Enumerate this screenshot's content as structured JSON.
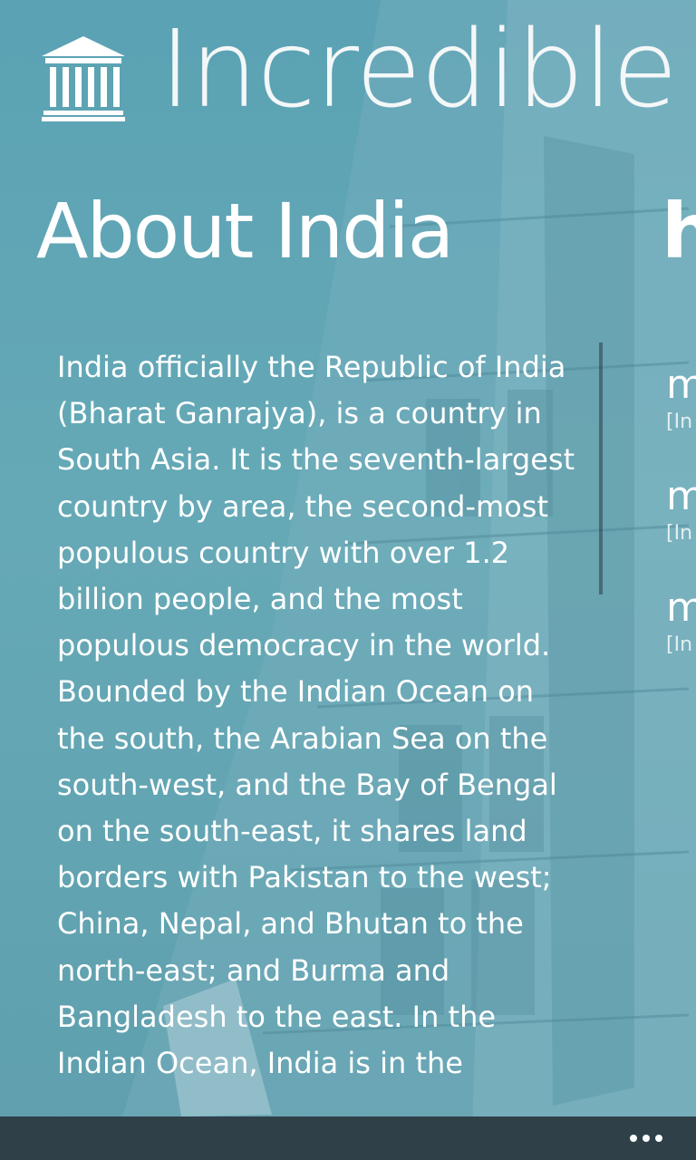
{
  "app": {
    "title": "Incredible",
    "icon": "museum-icon"
  },
  "pivot": {
    "current_header": "About India",
    "next_header_peek": "h"
  },
  "about": {
    "text": "India officially the Republic of India (Bharat Ganrajya), is a country in South Asia. It is the seventh-largest country by area, the second-most populous country with over 1.2 billion people, and the most populous democracy in the world. Bounded by the Indian Ocean on the south, the Arabian Sea on the south-west, and the Bay of Bengal on the south-east, it shares land borders with Pakistan to the west; China, Nepal, and Bhutan to the north-east; and Burma and Bangladesh to the east. In the Indian Ocean, India is in the"
  },
  "peek_items": [
    {
      "title": "m",
      "subtitle": "[In"
    },
    {
      "title": "m",
      "subtitle": "[In"
    },
    {
      "title": "m",
      "subtitle": "[In"
    }
  ],
  "app_bar": {
    "more_icon": "more-dots-icon"
  },
  "colors": {
    "background": "#5ea3b3",
    "app_bar": "#2f4049",
    "text": "#ffffff"
  }
}
